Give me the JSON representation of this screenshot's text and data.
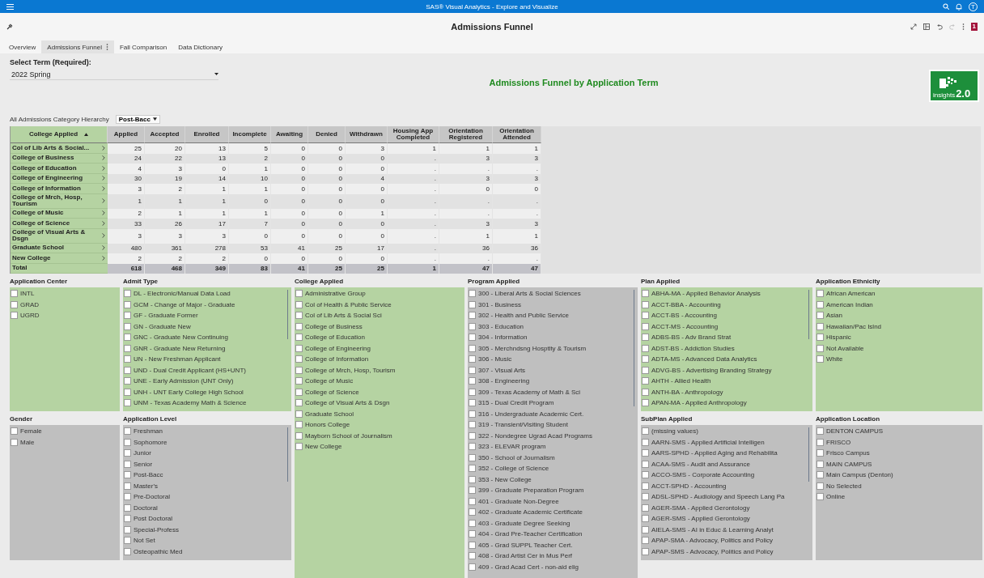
{
  "app_bar": {
    "title": "SAS® Visual Analytics - Explore and Visualize",
    "user_initial": "T"
  },
  "report": {
    "title": "Admissions Funnel",
    "alert_count": "1"
  },
  "tabs": [
    {
      "label": "Overview",
      "selected": false
    },
    {
      "label": "Admissions Funnel",
      "selected": true
    },
    {
      "label": "Fall Comparison",
      "selected": false
    },
    {
      "label": "Data Dictionary",
      "selected": false
    }
  ],
  "term": {
    "label": "Select Term (Required):",
    "value": "2022 Spring"
  },
  "chart_title": "Admissions Funnel by Application Term",
  "logo": {
    "word": "insights",
    "version": "2.0"
  },
  "hierarchy": {
    "label": "All Admissions Category Hierarchy",
    "value": "Post-Bacc"
  },
  "table": {
    "columns": [
      "College Applied",
      "Applied",
      "Accepted",
      "Enrolled",
      "Incomplete",
      "Awaiting",
      "Denied",
      "Withdrawn",
      "Housing App Completed",
      "Orientation Registered",
      "Orientation Attended"
    ],
    "rows": [
      {
        "college": "Col of Lib Arts & Social...",
        "values": [
          "25",
          "20",
          "13",
          "5",
          "0",
          "0",
          "3",
          "1",
          "1",
          "1"
        ]
      },
      {
        "college": "College of Business",
        "values": [
          "24",
          "22",
          "13",
          "2",
          "0",
          "0",
          "0",
          ".",
          "3",
          "3"
        ]
      },
      {
        "college": "College of Education",
        "values": [
          "4",
          "3",
          "0",
          "1",
          "0",
          "0",
          "0",
          ".",
          ".",
          "."
        ]
      },
      {
        "college": "College of Engineering",
        "values": [
          "30",
          "19",
          "14",
          "10",
          "0",
          "0",
          "4",
          ".",
          "3",
          "3"
        ]
      },
      {
        "college": "College of Information",
        "values": [
          "3",
          "2",
          "1",
          "1",
          "0",
          "0",
          "0",
          ".",
          "0",
          "0"
        ]
      },
      {
        "college": "College of Mrch, Hosp, Tourism",
        "values": [
          "1",
          "1",
          "1",
          "0",
          "0",
          "0",
          "0",
          ".",
          ".",
          "."
        ]
      },
      {
        "college": "College of Music",
        "values": [
          "2",
          "1",
          "1",
          "1",
          "0",
          "0",
          "1",
          ".",
          ".",
          "."
        ]
      },
      {
        "college": "College of Science",
        "values": [
          "33",
          "26",
          "17",
          "7",
          "0",
          "0",
          "0",
          ".",
          "3",
          "3"
        ]
      },
      {
        "college": "College of Visual Arts & Dsgn",
        "values": [
          "3",
          "3",
          "3",
          "0",
          "0",
          "0",
          "0",
          ".",
          "1",
          "1"
        ]
      },
      {
        "college": "Graduate School",
        "values": [
          "480",
          "361",
          "278",
          "53",
          "41",
          "25",
          "17",
          ".",
          "36",
          "36"
        ]
      },
      {
        "college": "New College",
        "values": [
          "2",
          "2",
          "2",
          "0",
          "0",
          "0",
          "0",
          ".",
          ".",
          "."
        ]
      }
    ],
    "total": {
      "label": "Total",
      "values": [
        "618",
        "468",
        "349",
        "83",
        "41",
        "25",
        "25",
        "1",
        "47",
        "47"
      ]
    }
  },
  "filter_columns": [
    {
      "panels": [
        {
          "title": "Application Center",
          "color": "#b5d3a2",
          "scrollable": false,
          "items": [
            {
              "label": "INTL",
              "checked": false
            },
            {
              "label": "GRAD",
              "checked": false
            },
            {
              "label": "UGRD",
              "checked": false
            }
          ]
        },
        {
          "title": "Gender",
          "color": "#bfbfbf",
          "scrollable": false,
          "items": [
            {
              "label": "Female",
              "checked": false
            },
            {
              "label": "Male",
              "checked": false
            }
          ]
        }
      ]
    },
    {
      "panels": [
        {
          "title": "Admit Type",
          "color": "#b5d3a2",
          "scrollable": true,
          "items": [
            {
              "label": "DL - Electronic/Manual Data Load",
              "checked": false
            },
            {
              "label": "GCM - Change of Major - Graduate",
              "checked": false
            },
            {
              "label": "GF - Graduate Former",
              "checked": false
            },
            {
              "label": "GN - Graduate New",
              "checked": false
            },
            {
              "label": "GNC - Graduate New Continuing",
              "checked": false
            },
            {
              "label": "GNR - Graduate New Returning",
              "checked": false
            },
            {
              "label": "UN - New Freshman Applicant",
              "checked": false
            },
            {
              "label": "UND - Dual Credit Applicant (HS+UNT)",
              "checked": false
            },
            {
              "label": "UNE - Early Admission (UNT Only)",
              "checked": false
            },
            {
              "label": "UNH - UNT Early College High School",
              "checked": false
            },
            {
              "label": "UNM - Texas Academy Math & Science",
              "checked": false
            }
          ]
        },
        {
          "title": "Application Level",
          "color": "#bfbfbf",
          "scrollable": true,
          "items": [
            {
              "label": "Freshman",
              "checked": false
            },
            {
              "label": "Sophomore",
              "checked": false
            },
            {
              "label": "Junior",
              "checked": false
            },
            {
              "label": "Senior",
              "checked": false
            },
            {
              "label": "Post-Bacc",
              "checked": false
            },
            {
              "label": "Master's",
              "checked": false
            },
            {
              "label": "Pre-Doctoral",
              "checked": false
            },
            {
              "label": "Doctoral",
              "checked": false
            },
            {
              "label": "Post Doctoral",
              "checked": false
            },
            {
              "label": "Special-Profess",
              "checked": false
            },
            {
              "label": "Not Set",
              "checked": false
            },
            {
              "label": "Osteopathic Med",
              "checked": false
            }
          ]
        }
      ]
    },
    {
      "panels": [
        {
          "title": "College Applied",
          "color": "#b5d3a2",
          "scrollable": false,
          "items": [
            {
              "label": "Administrative Group",
              "checked": false
            },
            {
              "label": "Col of Health & Public Service",
              "checked": false
            },
            {
              "label": "Col of Lib Arts & Social Sci",
              "checked": false
            },
            {
              "label": "College of Business",
              "checked": false
            },
            {
              "label": "College of Education",
              "checked": false
            },
            {
              "label": "College of Engineering",
              "checked": false
            },
            {
              "label": "College of Information",
              "checked": false
            },
            {
              "label": "College of Mrch, Hosp, Tourism",
              "checked": false
            },
            {
              "label": "College of Music",
              "checked": false
            },
            {
              "label": "College of Science",
              "checked": false
            },
            {
              "label": "College of Visual Arts & Dsgn",
              "checked": false
            },
            {
              "label": "Graduate School",
              "checked": false
            },
            {
              "label": "Honors College",
              "checked": false
            },
            {
              "label": "Mayborn School of Journalism",
              "checked": false
            },
            {
              "label": "New College",
              "checked": false
            }
          ]
        }
      ]
    },
    {
      "panels": [
        {
          "title": "Program Applied",
          "color": "#bfbfbf",
          "scrollable": true,
          "items": [
            {
              "label": "300 - Liberal Arts & Social Sciences",
              "checked": false
            },
            {
              "label": "301 - Business",
              "checked": false
            },
            {
              "label": "302 - Health and Public Service",
              "checked": false
            },
            {
              "label": "303 - Education",
              "checked": false
            },
            {
              "label": "304 - Information",
              "checked": false
            },
            {
              "label": "305 - Merchndsng Hosptlty & Tourism",
              "checked": false
            },
            {
              "label": "306 - Music",
              "checked": false
            },
            {
              "label": "307 - Visual Arts",
              "checked": false
            },
            {
              "label": "308 - Engineering",
              "checked": false
            },
            {
              "label": "309 - Texas Academy of Math & Sci",
              "checked": false
            },
            {
              "label": "315 - Dual Credit Program",
              "checked": false
            },
            {
              "label": "316 - Undergraduate Academic Cert.",
              "checked": false
            },
            {
              "label": "319 - Transient/Visiting Student",
              "checked": false
            },
            {
              "label": "322 - Nondegree Ugrad Acad Programs",
              "checked": false
            },
            {
              "label": "323 - ELEVAR program",
              "checked": false
            },
            {
              "label": "350 - School of Journalism",
              "checked": false
            },
            {
              "label": "352 - College of Science",
              "checked": false
            },
            {
              "label": "353 - New College",
              "checked": false
            },
            {
              "label": "399 - Graduate Preparation Program",
              "checked": false
            },
            {
              "label": "401 - Graduate Non-Degree",
              "checked": false
            },
            {
              "label": "402 - Graduate Academic Certificate",
              "checked": false
            },
            {
              "label": "403 - Graduate Degree Seeking",
              "checked": false
            },
            {
              "label": "404 - Grad Pre-Teacher Certification",
              "checked": false
            },
            {
              "label": "405 - Grad SUPPL Teacher Cert.",
              "checked": false
            },
            {
              "label": "408 - Grad Artist Cer in Mus Perf",
              "checked": false
            },
            {
              "label": "409 - Grad Acad Cert - non-aid elig",
              "checked": false
            }
          ]
        }
      ]
    },
    {
      "panels": [
        {
          "title": "Plan Applied",
          "color": "#b5d3a2",
          "scrollable": true,
          "items": [
            {
              "label": "ABHA-MA - Applied Behavior Analysis",
              "checked": false
            },
            {
              "label": "ACCT-BBA - Accounting",
              "checked": false
            },
            {
              "label": "ACCT-BS - Accounting",
              "checked": false
            },
            {
              "label": "ACCT-MS - Accounting",
              "checked": false
            },
            {
              "label": "ADBS-BS - Adv Brand Strat",
              "checked": false
            },
            {
              "label": "ADST-BS - Addiction Studies",
              "checked": false
            },
            {
              "label": "ADTA-MS - Advanced Data Analytics",
              "checked": false
            },
            {
              "label": "ADVG-BS - Advertising Branding Strategy",
              "checked": false
            },
            {
              "label": "AHTH - Allied Health",
              "checked": false
            },
            {
              "label": "ANTH-BA - Anthropology",
              "checked": false
            },
            {
              "label": "APAN-MA - Applied Anthropology",
              "checked": false
            }
          ]
        },
        {
          "title": "SubPlan Applied",
          "color": "#bfbfbf",
          "scrollable": true,
          "items": [
            {
              "label": "(missing values)",
              "checked": false
            },
            {
              "label": "AARN-SMS - Applied Artificial Intelligen",
              "checked": false
            },
            {
              "label": "AARS-SPHD - Applied Aging and Rehabilita",
              "checked": false
            },
            {
              "label": "ACAA-SMS - Audit and Assurance",
              "checked": false
            },
            {
              "label": "ACCO-SMS - Corporate Accounting",
              "checked": false
            },
            {
              "label": "ACCT-SPHD - Accounting",
              "checked": false
            },
            {
              "label": "ADSL-SPHD - Audiology and Speech Lang Pa",
              "checked": false
            },
            {
              "label": "AGER-SMA - Applied Gerontology",
              "checked": false
            },
            {
              "label": "AGER-SMS - Applied Gerontology",
              "checked": false
            },
            {
              "label": "AIELA-SMS - AI in Educ & Learning Analyt",
              "checked": false
            },
            {
              "label": "APAP-SMA - Advocacy, Politics and Policy",
              "checked": false
            },
            {
              "label": "APAP-SMS - Advocacy, Politics and Policy",
              "checked": false
            }
          ]
        }
      ]
    },
    {
      "panels": [
        {
          "title": "Application Ethnicity",
          "color": "#b5d3a2",
          "scrollable": false,
          "items": [
            {
              "label": "African American",
              "checked": false
            },
            {
              "label": "American Indian",
              "checked": false
            },
            {
              "label": "Asian",
              "checked": false
            },
            {
              "label": "Hawaiian/Pac Islnd",
              "checked": false
            },
            {
              "label": "Hispanic",
              "checked": false
            },
            {
              "label": "Not Available",
              "checked": false
            },
            {
              "label": "White",
              "checked": false
            }
          ]
        },
        {
          "title": "Application Location",
          "color": "#bfbfbf",
          "scrollable": false,
          "items": [
            {
              "label": "DENTON CAMPUS",
              "checked": false
            },
            {
              "label": "FRISCO",
              "checked": false
            },
            {
              "label": "Frisco Campus",
              "checked": false
            },
            {
              "label": "MAIN CAMPUS",
              "checked": false
            },
            {
              "label": "Main Campus (Denton)",
              "checked": false
            },
            {
              "label": "No Selected",
              "checked": false
            },
            {
              "label": "Online",
              "checked": false
            }
          ]
        }
      ]
    }
  ]
}
